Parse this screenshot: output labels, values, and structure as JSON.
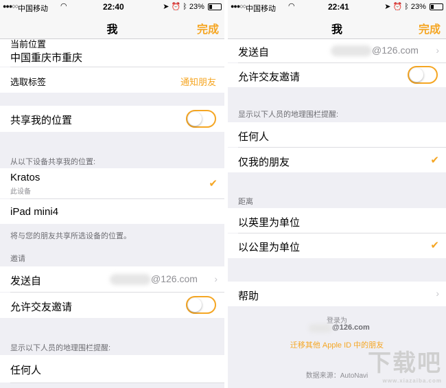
{
  "left": {
    "status": {
      "carrier": "中国移动",
      "time": "22:40",
      "battery": "23%"
    },
    "nav": {
      "title": "我",
      "done": "完成"
    },
    "current_location_label": "当前位置",
    "current_location": "中国重庆市重庆",
    "choose_tag": "选取标签",
    "notify_friends": "通知朋友",
    "share_location": "共享我的位置",
    "share_from_header": "从以下设备共享我的位置:",
    "device1_name": "Kratos",
    "device1_sub": "此设备",
    "device2_name": "iPad mini4",
    "share_footer": "将与您的朋友共享所选设备的位置。",
    "invite_header": "邀请",
    "send_from": "发送自",
    "email_suffix": "@126.com",
    "allow_invites": "允许交友邀请",
    "geofence_header": "显示以下人员的地理围栏提醒:",
    "anyone": "任何人"
  },
  "right": {
    "status": {
      "carrier": "中国移动",
      "time": "22:41",
      "battery": "23%"
    },
    "nav": {
      "title": "我",
      "done": "完成"
    },
    "send_from": "发送自",
    "email_suffix": "@126.com",
    "allow_invites": "允许交友邀请",
    "geofence_header": "显示以下人员的地理围栏提醒:",
    "anyone": "任何人",
    "friends_only": "仅我的朋友",
    "distance_header": "距离",
    "miles": "以英里为单位",
    "km": "以公里为单位",
    "help": "帮助",
    "signed_in_as": "登录为",
    "signed_email": "@126.com",
    "migrate": "迁移其他 Apple ID 中的朋友",
    "data_source": "数据来源：AutoNavi",
    "watermark": "下载吧",
    "watermark_url": "www.xiazaiba.com"
  },
  "accent_color": "#f5a623",
  "icons": [
    "signal-icon",
    "wifi-icon",
    "location-arrow-icon",
    "alarm-icon",
    "bluetooth-icon",
    "battery-icon",
    "checkmark-icon",
    "chevron-right-icon"
  ]
}
